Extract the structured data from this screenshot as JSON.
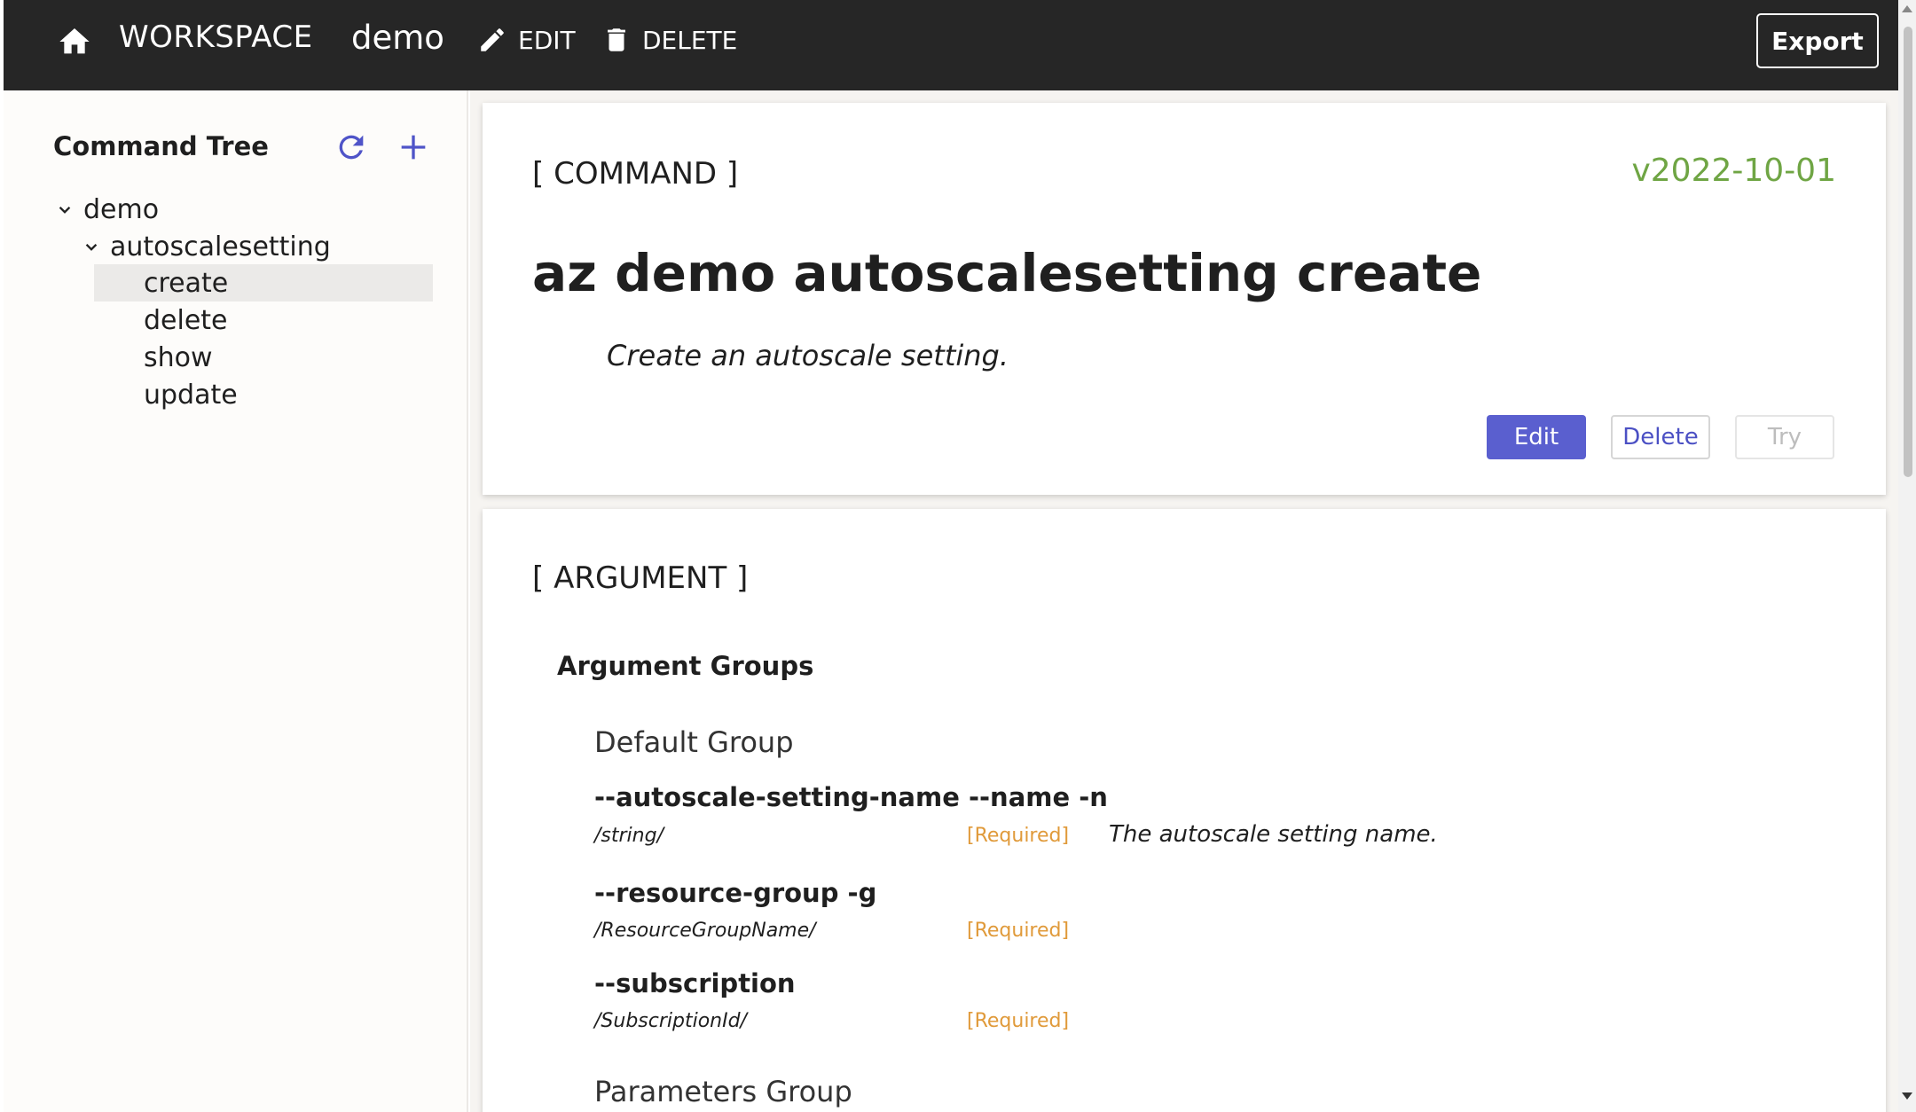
{
  "header": {
    "brand": "WORKSPACE",
    "workspace_name": "demo",
    "edit_label": "EDIT",
    "delete_label": "DELETE",
    "export_label": "Export"
  },
  "sidebar": {
    "title": "Command Tree",
    "tree": {
      "root": "demo",
      "group": "autoscalesetting",
      "commands": [
        "create",
        "delete",
        "show",
        "update"
      ],
      "selected": "create"
    }
  },
  "command": {
    "section_label": "[ COMMAND ]",
    "version": "v2022-10-01",
    "name": "az demo autoscalesetting create",
    "description": "Create an autoscale setting.",
    "buttons": {
      "edit": "Edit",
      "delete": "Delete",
      "try": "Try"
    }
  },
  "argument": {
    "section_label": "[ ARGUMENT ]",
    "groups_title": "Argument Groups",
    "groups": [
      {
        "name": "Default Group",
        "args": [
          {
            "options": "--autoscale-setting-name --name -n",
            "type": "/string/",
            "required": "[Required]",
            "help": "The autoscale setting name."
          },
          {
            "options": "--resource-group -g",
            "type": "/ResourceGroupName/",
            "required": "[Required]",
            "help": ""
          },
          {
            "options": "--subscription",
            "type": "/SubscriptionId/",
            "required": "[Required]",
            "help": ""
          }
        ]
      },
      {
        "name": "Parameters Group",
        "args": []
      }
    ]
  },
  "colors": {
    "topbar": "#262626",
    "accent": "#5a5fcf",
    "version": "#6fa544",
    "required": "#e09a3a"
  }
}
